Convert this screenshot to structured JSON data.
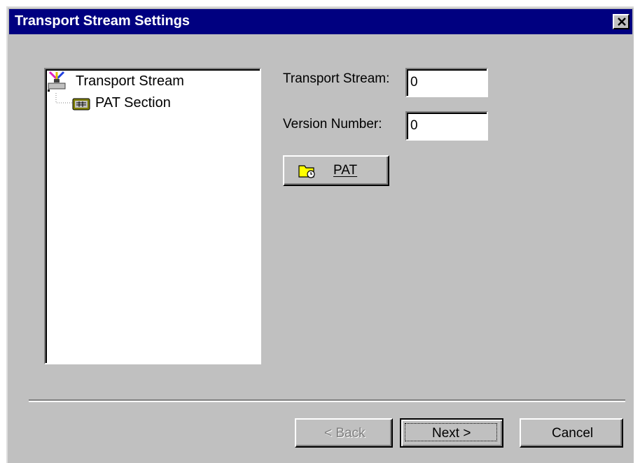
{
  "window": {
    "title": "Transport Stream Settings",
    "close_symbol": "✕"
  },
  "tree": {
    "root": {
      "label": "Transport Stream",
      "icon": "transport-stream-icon"
    },
    "children": [
      {
        "label": "PAT Section",
        "icon": "section-table-icon"
      }
    ]
  },
  "form": {
    "transport_stream_label": "Transport Stream:",
    "transport_stream_value": "0",
    "version_number_label": "Version Number:",
    "version_number_value": "0",
    "pat_button_label": "PAT",
    "pat_button_icon": "folder-clock-icon"
  },
  "footer": {
    "back_label": "< Back",
    "next_label": "Next >",
    "cancel_label": "Cancel"
  },
  "colors": {
    "titlebar": "#000080",
    "face": "#c0c0c0",
    "disabled_text": "#808080"
  }
}
